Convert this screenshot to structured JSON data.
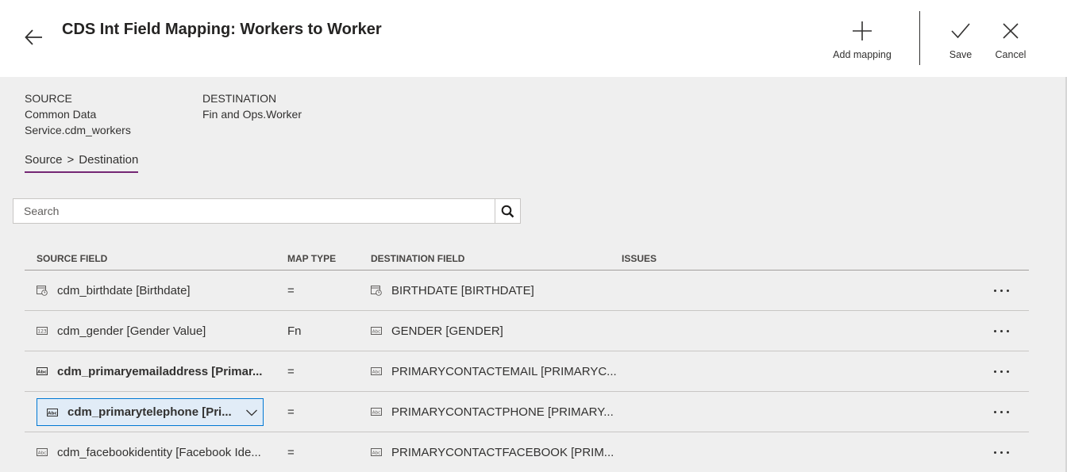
{
  "header": {
    "title": "CDS Int Field Mapping: Workers to Worker",
    "add_mapping_label": "Add mapping",
    "save_label": "Save",
    "cancel_label": "Cancel"
  },
  "source": {
    "heading": "SOURCE",
    "value_line1": "Common Data",
    "value_line2": "Service.cdm_workers"
  },
  "destination": {
    "heading": "DESTINATION",
    "value": "Fin and Ops.Worker"
  },
  "tab": {
    "source_label": "Source",
    "separator": ">",
    "destination_label": "Destination"
  },
  "search": {
    "placeholder": "Search"
  },
  "grid": {
    "columns": [
      "SOURCE FIELD",
      "MAP TYPE",
      "DESTINATION FIELD",
      "ISSUES"
    ],
    "rows": [
      {
        "source": "cdm_birthdate [Birthdate]",
        "source_icon": "date-field-icon",
        "map_type": "=",
        "destination": "BIRTHDATE [BIRTHDATE]",
        "destination_icon": "date-field-icon"
      },
      {
        "source": "cdm_gender [Gender Value]",
        "source_icon": "number-field-icon",
        "map_type": "Fn",
        "destination": "GENDER [GENDER]",
        "destination_icon": "text-field-icon"
      },
      {
        "source": "cdm_primaryemailaddress [Primar...",
        "source_icon": "text-field-icon",
        "map_type": "=",
        "destination": "PRIMARYCONTACTEMAIL [PRIMARYC...",
        "destination_icon": "text-field-icon"
      },
      {
        "source": "cdm_primarytelephone [Pri...",
        "source_icon": "text-field-icon",
        "map_type": "=",
        "destination": "PRIMARYCONTACTPHONE [PRIMARY...",
        "destination_icon": "text-field-icon"
      },
      {
        "source": "cdm_facebookidentity [Facebook Ide...",
        "source_icon": "text-field-icon",
        "map_type": "=",
        "destination": "PRIMARYCONTACTFACEBOOK [PRIM...",
        "destination_icon": "text-field-icon"
      }
    ]
  },
  "colors": {
    "accent": "#742774",
    "selection_border": "#0078d4",
    "selection_fill": "#e1ecf7"
  }
}
